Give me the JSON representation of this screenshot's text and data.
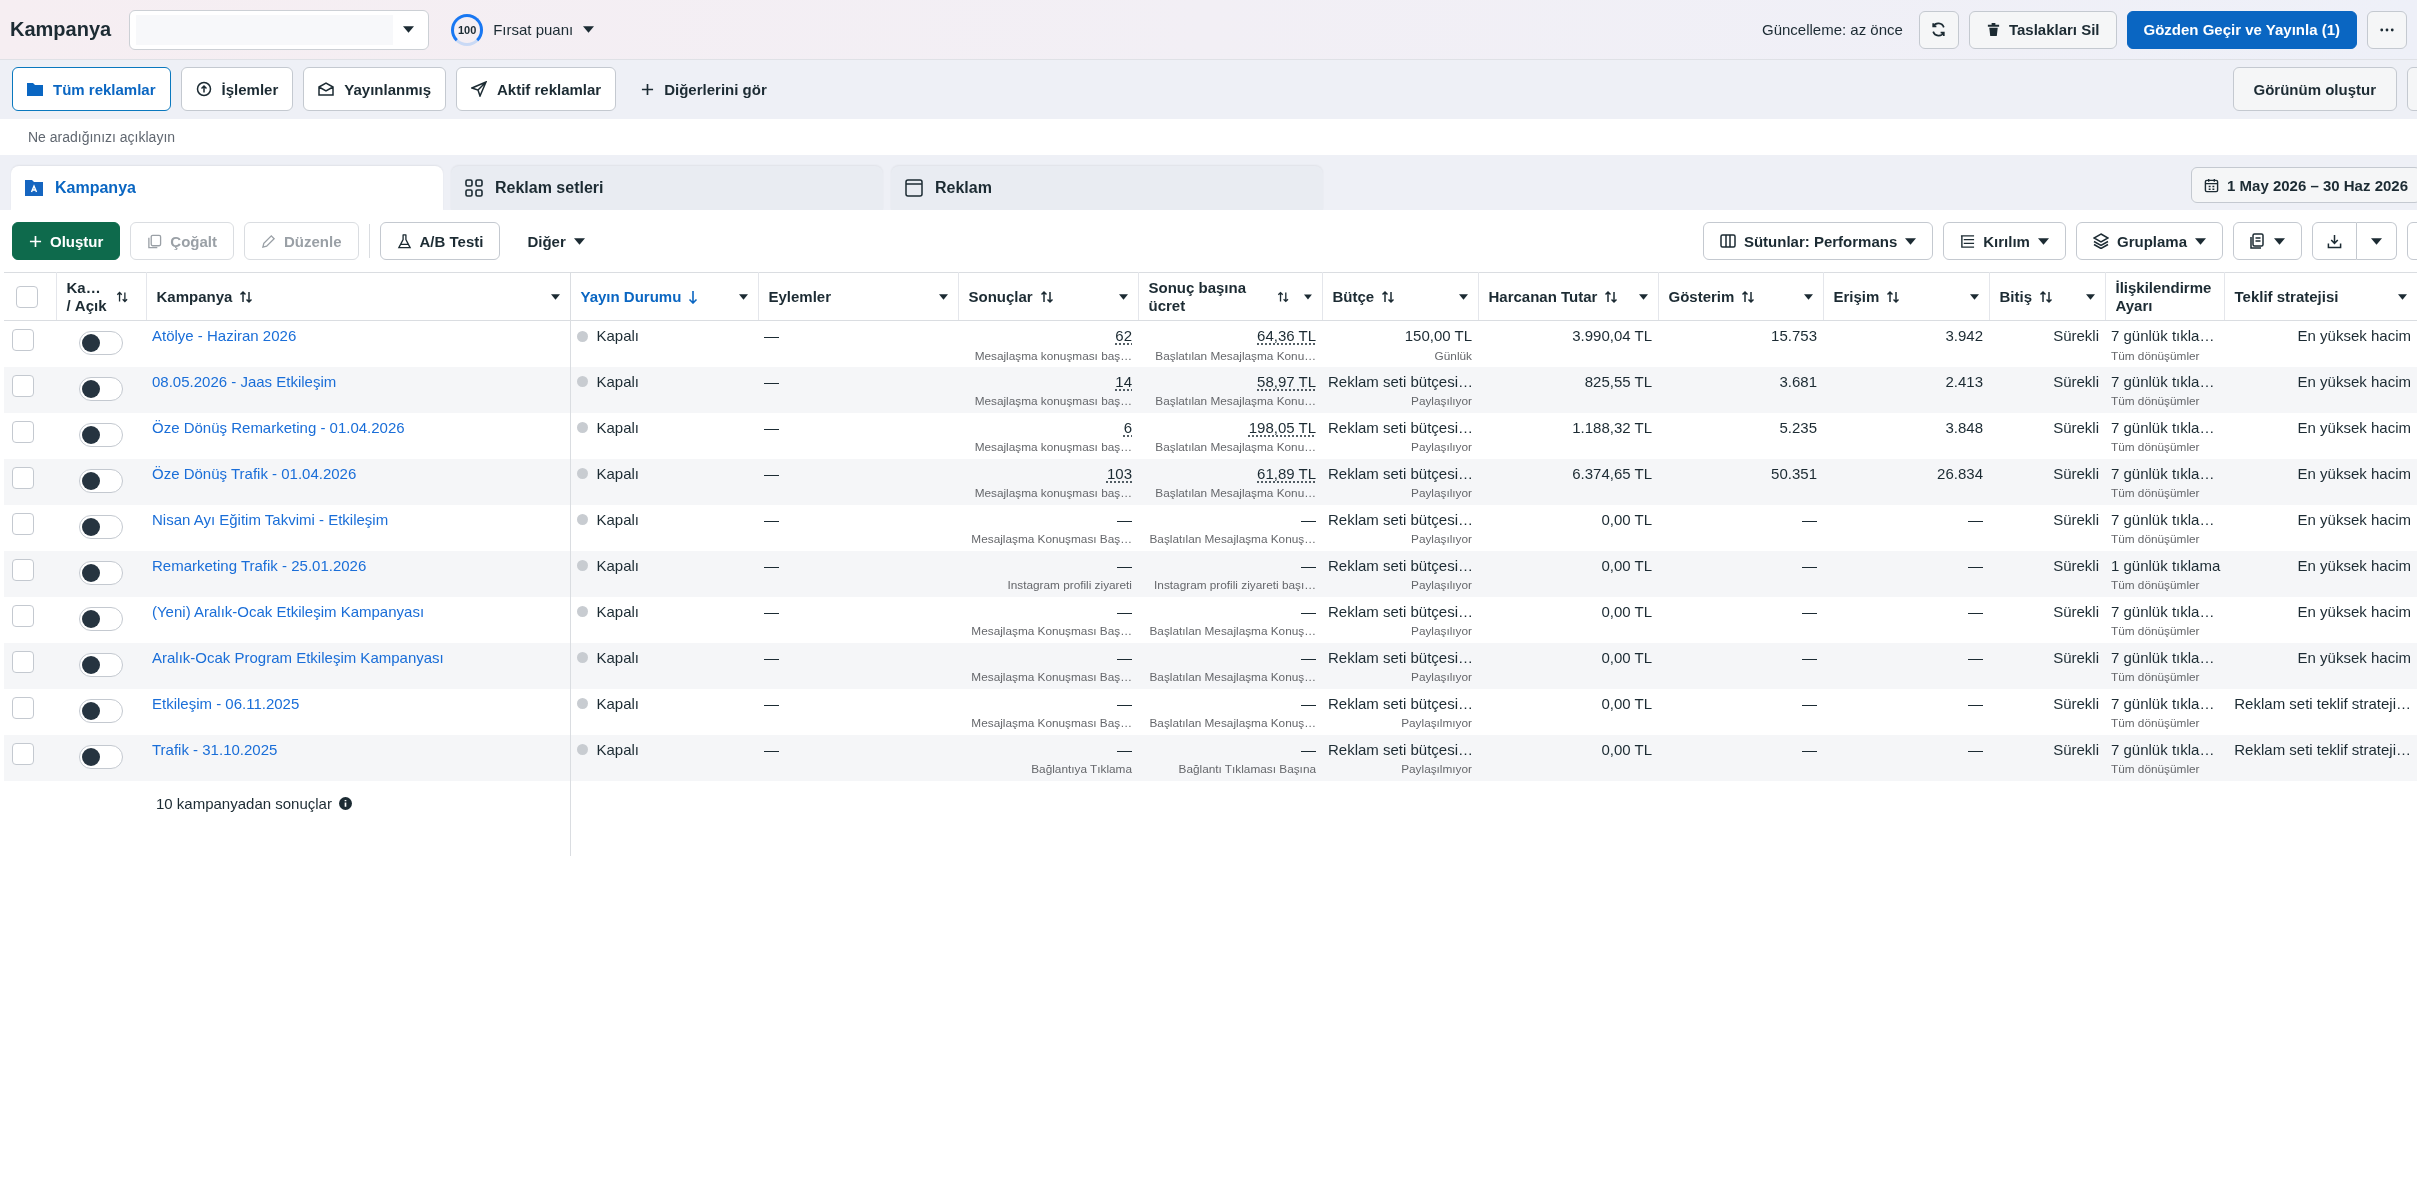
{
  "header": {
    "title": "Kampanya",
    "score": "100",
    "score_label": "Fırsat puanı",
    "update_status": "Güncelleme: az önce",
    "delete_drafts": "Taslakları Sil",
    "publish": "Gözden Geçir ve Yayınla (1)"
  },
  "filters": [
    {
      "label": "Tüm reklamlar",
      "selected": true
    },
    {
      "label": "İşlemler",
      "selected": false
    },
    {
      "label": "Yayınlanmış",
      "selected": false
    },
    {
      "label": "Aktif reklamlar",
      "selected": false
    }
  ],
  "more_filters": "Diğerlerini gör",
  "create_view": "Görünüm oluştur",
  "search": {
    "placeholder": "Ne aradığınızı açıklayın"
  },
  "levels": [
    {
      "label": "Kampanya",
      "selected": true
    },
    {
      "label": "Reklam setleri",
      "selected": false
    },
    {
      "label": "Reklam",
      "selected": false
    }
  ],
  "date_range": "1 May 2026 – 30 Haz 2026",
  "toolbar": [
    {
      "label": "Oluştur",
      "kind": "primary",
      "disabled": false
    },
    {
      "label": "Çoğalt",
      "kind": "outline",
      "disabled": true
    },
    {
      "label": "Düzenle",
      "kind": "outline",
      "disabled": true
    },
    {
      "label": "A/B Testi",
      "kind": "outline",
      "disabled": false
    }
  ],
  "more_menu": "Diğer",
  "view_controls": [
    {
      "label": "Sütunlar: Performans"
    },
    {
      "label": "Kırılım"
    },
    {
      "label": "Gruplama"
    }
  ],
  "select_all": {
    "checked": false
  },
  "columns": [
    {
      "label": "Ka… / Açık",
      "kind": "toggle",
      "sorted": false
    },
    {
      "label": "Kampanya",
      "kind": "sortable",
      "sorted": false
    },
    {
      "label": "Yayın Durumu",
      "kind": "plain",
      "sorted": true
    },
    {
      "label": "Eylemler",
      "kind": "plain",
      "sorted": false
    },
    {
      "label": "Sonuçlar",
      "kind": "sortable",
      "sorted": false
    },
    {
      "label": "Sonuç başına ücret",
      "kind": "sortable",
      "sorted": false
    },
    {
      "label": "Bütçe",
      "kind": "sortable",
      "sorted": false
    },
    {
      "label": "Harcanan Tutar",
      "kind": "sortable",
      "sorted": false
    },
    {
      "label": "Gösterim",
      "kind": "sortable",
      "sorted": false
    },
    {
      "label": "Erişim",
      "kind": "sortable",
      "sorted": false
    },
    {
      "label": "Bitiş",
      "kind": "sortable",
      "sorted": false
    },
    {
      "label": "İlişkilendirme Ayarı",
      "kind": "plain",
      "sorted": false
    },
    {
      "label": "Teklif stratejisi",
      "kind": "plain",
      "sorted": false
    }
  ],
  "rows": [
    {
      "checked": false,
      "on": false,
      "name": "Atölye - Haziran 2026",
      "status": "Kapalı",
      "actions": "—",
      "link": true,
      "results": "62",
      "results_note": "Mesajlaşma konuşması baş…",
      "cost": "64,36 TL",
      "cost_note": "Başlatılan Mesajlaşma Konu…",
      "budget": "150,00 TL",
      "budget_note": "Günlük",
      "spent": "3.990,04 TL",
      "impressions": "15.753",
      "reach": "3.942",
      "ends": "Sürekli",
      "attribution": "7 günlük tıkla…",
      "attribution_note": "Tüm dönüşümler",
      "bid": "En yüksek hacim"
    },
    {
      "checked": false,
      "on": false,
      "name": "08.05.2026 - Jaas Etkileşim",
      "status": "Kapalı",
      "actions": "—",
      "link": true,
      "results": "14",
      "results_note": "Mesajlaşma konuşması baş…",
      "cost": "58,97 TL",
      "cost_note": "Başlatılan Mesajlaşma Konu…",
      "budget": "Reklam seti bütçesi…",
      "budget_note": "Paylaşılıyor",
      "spent": "825,55 TL",
      "impressions": "3.681",
      "reach": "2.413",
      "ends": "Sürekli",
      "attribution": "7 günlük tıkla…",
      "attribution_note": "Tüm dönüşümler",
      "bid": "En yüksek hacim"
    },
    {
      "checked": false,
      "on": false,
      "name": "Öze Dönüş Remarketing - 01.04.2026",
      "status": "Kapalı",
      "actions": "—",
      "link": true,
      "results": "6",
      "results_note": "Mesajlaşma konuşması baş…",
      "cost": "198,05 TL",
      "cost_note": "Başlatılan Mesajlaşma Konu…",
      "budget": "Reklam seti bütçesi…",
      "budget_note": "Paylaşılıyor",
      "spent": "1.188,32 TL",
      "impressions": "5.235",
      "reach": "3.848",
      "ends": "Sürekli",
      "attribution": "7 günlük tıkla…",
      "attribution_note": "Tüm dönüşümler",
      "bid": "En yüksek hacim"
    },
    {
      "checked": false,
      "on": false,
      "name": "Öze Dönüş Trafik - 01.04.2026",
      "status": "Kapalı",
      "actions": "—",
      "link": true,
      "results": "103",
      "results_note": "Mesajlaşma konuşması baş…",
      "cost": "61,89 TL",
      "cost_note": "Başlatılan Mesajlaşma Konu…",
      "budget": "Reklam seti bütçesi…",
      "budget_note": "Paylaşılıyor",
      "spent": "6.374,65 TL",
      "impressions": "50.351",
      "reach": "26.834",
      "ends": "Sürekli",
      "attribution": "7 günlük tıkla…",
      "attribution_note": "Tüm dönüşümler",
      "bid": "En yüksek hacim"
    },
    {
      "checked": false,
      "on": false,
      "name": "Nisan Ayı Eğitim Takvimi - Etkileşim",
      "status": "Kapalı",
      "actions": "—",
      "link": false,
      "results": "—",
      "results_note": "Mesajlaşma Konuşması Baş…",
      "cost": "—",
      "cost_note": "Başlatılan Mesajlaşma Konuş…",
      "budget": "Reklam seti bütçesi…",
      "budget_note": "Paylaşılıyor",
      "spent": "0,00 TL",
      "impressions": "—",
      "reach": "—",
      "ends": "Sürekli",
      "attribution": "7 günlük tıkla…",
      "attribution_note": "Tüm dönüşümler",
      "bid": "En yüksek hacim"
    },
    {
      "checked": false,
      "on": false,
      "name": "Remarketing Trafik - 25.01.2026",
      "status": "Kapalı",
      "actions": "—",
      "link": false,
      "results": "—",
      "results_note": "Instagram profili ziyareti",
      "cost": "—",
      "cost_note": "Instagram profili ziyareti başı…",
      "budget": "Reklam seti bütçesi…",
      "budget_note": "Paylaşılıyor",
      "spent": "0,00 TL",
      "impressions": "—",
      "reach": "—",
      "ends": "Sürekli",
      "attribution": "1 günlük tıklama",
      "attribution_note": "Tüm dönüşümler",
      "bid": "En yüksek hacim"
    },
    {
      "checked": false,
      "on": false,
      "name": "(Yeni) Aralık-Ocak Etkileşim Kampanyası",
      "status": "Kapalı",
      "actions": "—",
      "link": false,
      "results": "—",
      "results_note": "Mesajlaşma Konuşması Baş…",
      "cost": "—",
      "cost_note": "Başlatılan Mesajlaşma Konuş…",
      "budget": "Reklam seti bütçesi…",
      "budget_note": "Paylaşılıyor",
      "spent": "0,00 TL",
      "impressions": "—",
      "reach": "—",
      "ends": "Sürekli",
      "attribution": "7 günlük tıkla…",
      "attribution_note": "Tüm dönüşümler",
      "bid": "En yüksek hacim"
    },
    {
      "checked": false,
      "on": false,
      "name": "Aralık-Ocak Program Etkileşim Kampanyası",
      "status": "Kapalı",
      "actions": "—",
      "link": false,
      "results": "—",
      "results_note": "Mesajlaşma Konuşması Baş…",
      "cost": "—",
      "cost_note": "Başlatılan Mesajlaşma Konuş…",
      "budget": "Reklam seti bütçesi…",
      "budget_note": "Paylaşılıyor",
      "spent": "0,00 TL",
      "impressions": "—",
      "reach": "—",
      "ends": "Sürekli",
      "attribution": "7 günlük tıkla…",
      "attribution_note": "Tüm dönüşümler",
      "bid": "En yüksek hacim"
    },
    {
      "checked": false,
      "on": false,
      "name": "Etkileşim - 06.11.2025",
      "status": "Kapalı",
      "actions": "—",
      "link": false,
      "results": "—",
      "results_note": "Mesajlaşma Konuşması Baş…",
      "cost": "—",
      "cost_note": "Başlatılan Mesajlaşma Konuş…",
      "budget": "Reklam seti bütçesi…",
      "budget_note": "Paylaşılmıyor",
      "spent": "0,00 TL",
      "impressions": "—",
      "reach": "—",
      "ends": "Sürekli",
      "attribution": "7 günlük tıkla…",
      "attribution_note": "Tüm dönüşümler",
      "bid": "Reklam seti teklif strateji…"
    },
    {
      "checked": false,
      "on": false,
      "name": "Trafik - 31.10.2025",
      "status": "Kapalı",
      "actions": "—",
      "link": false,
      "results": "—",
      "results_note": "Bağlantıya Tıklama",
      "cost": "—",
      "cost_note": "Bağlantı Tıklaması Başına",
      "budget": "Reklam seti bütçesi…",
      "budget_note": "Paylaşılmıyor",
      "spent": "0,00 TL",
      "impressions": "—",
      "reach": "—",
      "ends": "Sürekli",
      "attribution": "7 günlük tıkla…",
      "attribution_note": "Tüm dönüşümler",
      "bid": "Reklam seti teklif strateji…"
    }
  ],
  "footer": "10 kampanyadan sonuçlar"
}
